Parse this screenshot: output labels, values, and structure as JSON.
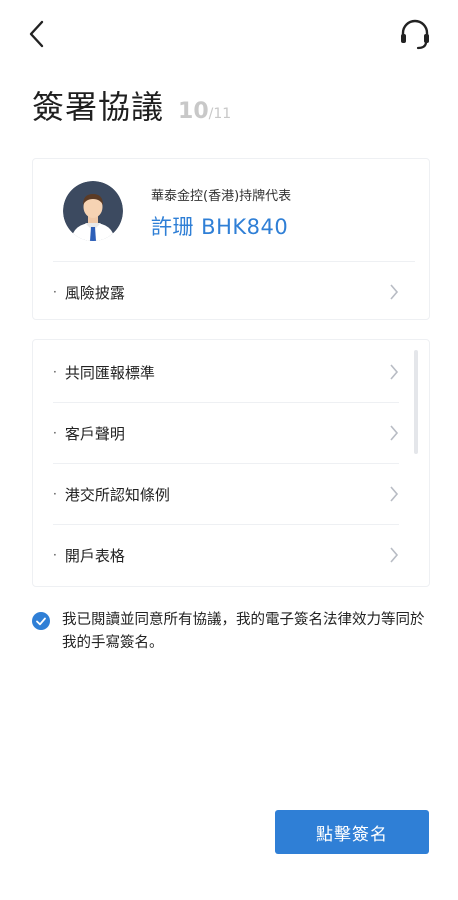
{
  "header": {
    "back_icon": "chevron-left-icon",
    "support_icon": "headset-icon"
  },
  "title": {
    "text": "簽署協議",
    "step_current": "10",
    "step_total": "/11"
  },
  "representative": {
    "label": "華泰金控(香港)持牌代表",
    "name": "許珊  BHK840",
    "avatar_icon": "person-avatar-icon"
  },
  "card1_items": [
    {
      "label": "風險披露"
    }
  ],
  "card2_items": [
    {
      "label": "共同匯報標準"
    },
    {
      "label": "客戶聲明"
    },
    {
      "label": "港交所認知條例"
    },
    {
      "label": "開戶表格"
    }
  ],
  "bullet": "·",
  "agreement": {
    "checked": true,
    "text": "我已閱讀並同意所有協議，我的電子簽名法律效力等同於我的手寫簽名。"
  },
  "sign_button": {
    "label": "點擊簽名"
  },
  "colors": {
    "accent": "#2f7fd6",
    "divider": "#eef0f3"
  }
}
